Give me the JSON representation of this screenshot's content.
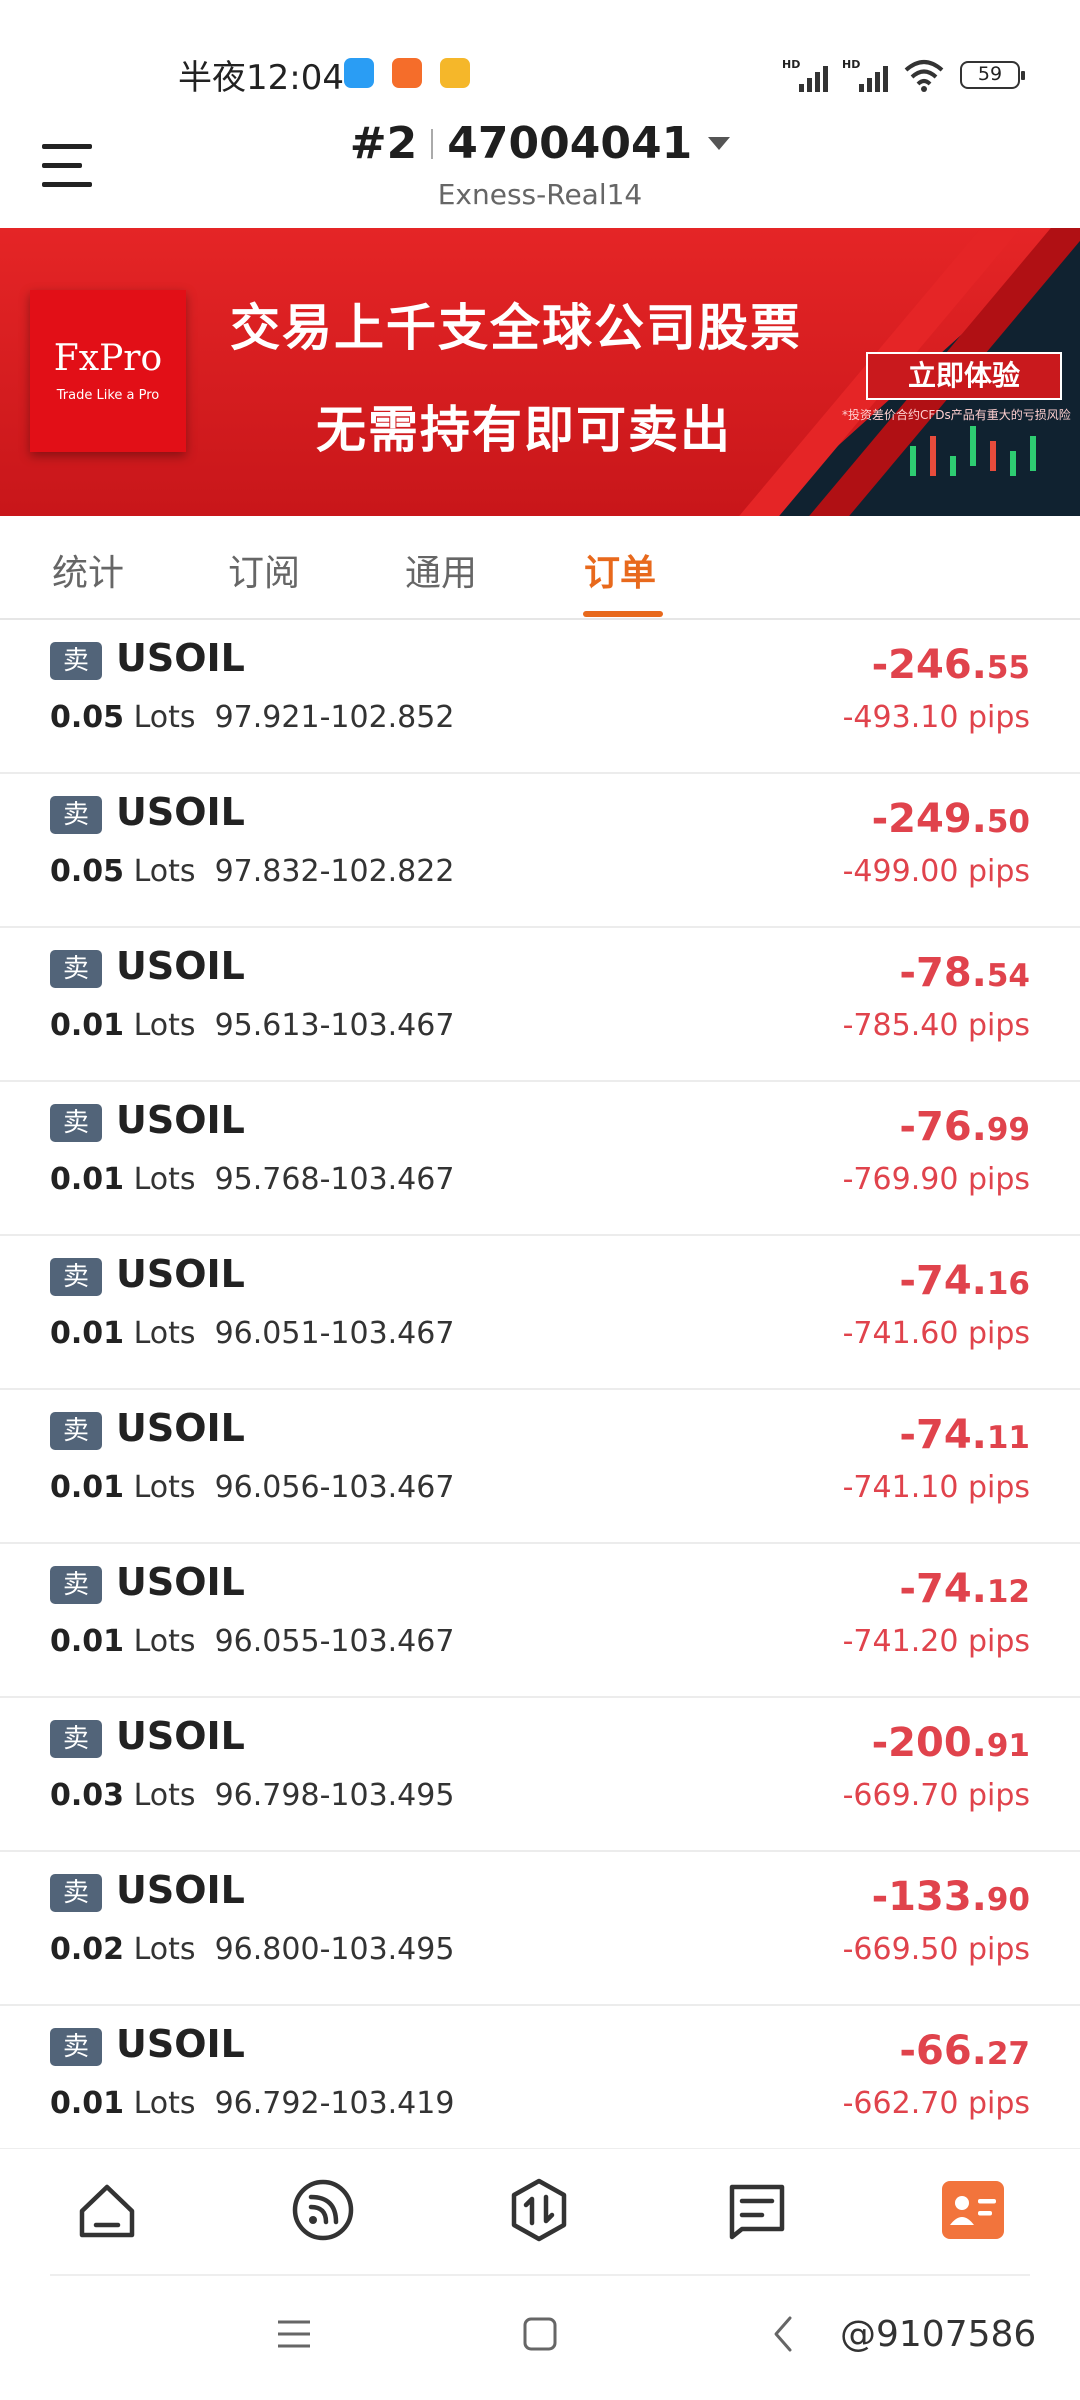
{
  "status_bar": {
    "time": "半夜12:04",
    "battery": "59"
  },
  "header": {
    "account_index": "#2",
    "account_number": "47004041",
    "server": "Exness-Real14"
  },
  "banner": {
    "logo_name": "FxPro",
    "logo_tagline": "Trade Like a Pro",
    "headline": "交易上千支全球公司股票",
    "subheadline": "无需持有即可卖出",
    "cta": "立即体验",
    "disclaimer": "*投资差价合约CFDs产品有重大的亏损风险"
  },
  "tabs": [
    {
      "label": "统计",
      "active": false
    },
    {
      "label": "订阅",
      "active": false
    },
    {
      "label": "通用",
      "active": false
    },
    {
      "label": "订单",
      "active": true
    }
  ],
  "orders": [
    {
      "side": "卖",
      "symbol": "USOIL",
      "lots": "0.05",
      "lots_unit": "Lots",
      "prices": "97.921-102.852",
      "pnl_int": "-246.",
      "pnl_dec": "55",
      "pips": "-493.10 pips"
    },
    {
      "side": "卖",
      "symbol": "USOIL",
      "lots": "0.05",
      "lots_unit": "Lots",
      "prices": "97.832-102.822",
      "pnl_int": "-249.",
      "pnl_dec": "50",
      "pips": "-499.00 pips"
    },
    {
      "side": "卖",
      "symbol": "USOIL",
      "lots": "0.01",
      "lots_unit": "Lots",
      "prices": "95.613-103.467",
      "pnl_int": "-78.",
      "pnl_dec": "54",
      "pips": "-785.40 pips"
    },
    {
      "side": "卖",
      "symbol": "USOIL",
      "lots": "0.01",
      "lots_unit": "Lots",
      "prices": "95.768-103.467",
      "pnl_int": "-76.",
      "pnl_dec": "99",
      "pips": "-769.90 pips"
    },
    {
      "side": "卖",
      "symbol": "USOIL",
      "lots": "0.01",
      "lots_unit": "Lots",
      "prices": "96.051-103.467",
      "pnl_int": "-74.",
      "pnl_dec": "16",
      "pips": "-741.60 pips"
    },
    {
      "side": "卖",
      "symbol": "USOIL",
      "lots": "0.01",
      "lots_unit": "Lots",
      "prices": "96.056-103.467",
      "pnl_int": "-74.",
      "pnl_dec": "11",
      "pips": "-741.10 pips"
    },
    {
      "side": "卖",
      "symbol": "USOIL",
      "lots": "0.01",
      "lots_unit": "Lots",
      "prices": "96.055-103.467",
      "pnl_int": "-74.",
      "pnl_dec": "12",
      "pips": "-741.20 pips"
    },
    {
      "side": "卖",
      "symbol": "USOIL",
      "lots": "0.03",
      "lots_unit": "Lots",
      "prices": "96.798-103.495",
      "pnl_int": "-200.",
      "pnl_dec": "91",
      "pips": "-669.70 pips"
    },
    {
      "side": "卖",
      "symbol": "USOIL",
      "lots": "0.02",
      "lots_unit": "Lots",
      "prices": "96.800-103.495",
      "pnl_int": "-133.",
      "pnl_dec": "90",
      "pips": "-669.50 pips"
    },
    {
      "side": "卖",
      "symbol": "USOIL",
      "lots": "0.01",
      "lots_unit": "Lots",
      "prices": "96.792-103.419",
      "pnl_int": "-66.",
      "pnl_dec": "27",
      "pips": "-662.70 pips"
    }
  ],
  "bottom_nav": [
    {
      "icon": "home-icon",
      "active": false
    },
    {
      "icon": "feed-icon",
      "active": false
    },
    {
      "icon": "trade-icon",
      "active": false
    },
    {
      "icon": "message-icon",
      "active": false
    },
    {
      "icon": "profile-card-icon",
      "active": true
    }
  ],
  "watermark": "@9107586",
  "colors": {
    "accent": "#e8691c",
    "loss": "#e0434c",
    "sell_badge": "#526479",
    "banner_red": "#e52526"
  }
}
